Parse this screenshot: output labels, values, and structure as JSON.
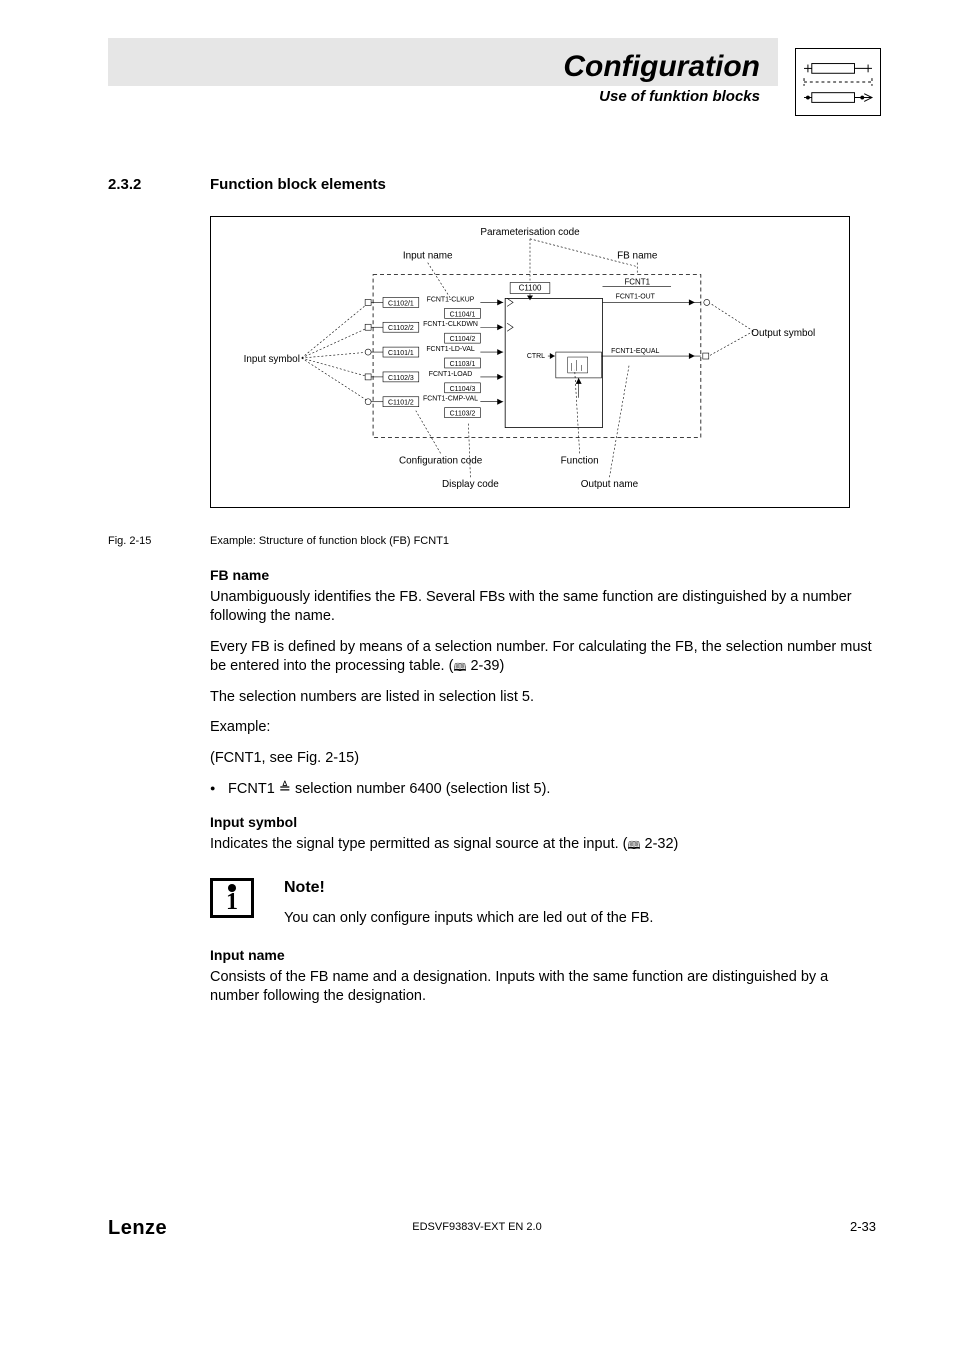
{
  "header": {
    "title": "Configuration",
    "subtitle": "Use of funktion blocks"
  },
  "section": {
    "number": "2.3.2",
    "title": "Function block elements"
  },
  "figure": {
    "labels": {
      "parameterisation_code": "Parameterisation code",
      "input_name": "Input name",
      "fb_name": "FB name",
      "input_symbol": "Input symbol",
      "output_symbol": "Output symbol",
      "configuration_code": "Configuration code",
      "display_code": "Display code",
      "function": "Function",
      "output_name": "Output name"
    },
    "block": {
      "param_code": "C1100",
      "fb_name": "FCNT1",
      "output1": "FCNT1-OUT",
      "output2": "FCNT1-EQUAL",
      "ctrl": "CTRL",
      "inputs": [
        {
          "cfg": "C1102/1",
          "name": "FCNT1-CLKUP",
          "disp": "C1104/1"
        },
        {
          "cfg": "C1102/2",
          "name": "FCNT1-CLKDWN",
          "disp": "C1104/2"
        },
        {
          "cfg": "C1101/1",
          "name": "FCNT1-LD-VAL",
          "disp": "C1103/1"
        },
        {
          "cfg": "C1102/3",
          "name": "FCNT1-LOAD",
          "disp": "C1104/3"
        },
        {
          "cfg": "C1101/2",
          "name": "FCNT1-CMP-VAL",
          "disp": "C1103/2"
        }
      ]
    },
    "caption_label": "Fig. 2-15",
    "caption": "Example: Structure of function block (FB) FCNT1"
  },
  "text": {
    "fb_name_h": "FB name",
    "fb_name_p1": "Unambiguously identifies the FB. Several FBs with the same function are distinguished by a number following the name.",
    "fb_name_p2a": "Every FB is defined by means of a selection number. For calculating the FB, the selection number must be entered into the processing table. (",
    "fb_name_p2_ref": " 2-39)",
    "fb_name_p3": "The selection numbers are listed in selection list 5.",
    "example_h": "Example:",
    "example_p": "(FCNT1, see Fig. 2-15)",
    "example_bullet_a": "FCNT1 ",
    "example_bullet_b": " selection number 6400 (selection list 5).",
    "input_symbol_h": "Input symbol",
    "input_symbol_p_a": "Indicates the signal type permitted as signal source at the input. (",
    "input_symbol_p_ref": " 2-32)",
    "note_title": "Note!",
    "note_text": "You can only configure inputs which are led out of the FB.",
    "input_name_h": "Input name",
    "input_name_p": "Consists of the FB name and a designation. Inputs with the same function are distinguished by a number following the designation."
  },
  "footer": {
    "logo": "Lenze",
    "center": "EDSVF9383V-EXT EN 2.0",
    "right": "2-33"
  }
}
